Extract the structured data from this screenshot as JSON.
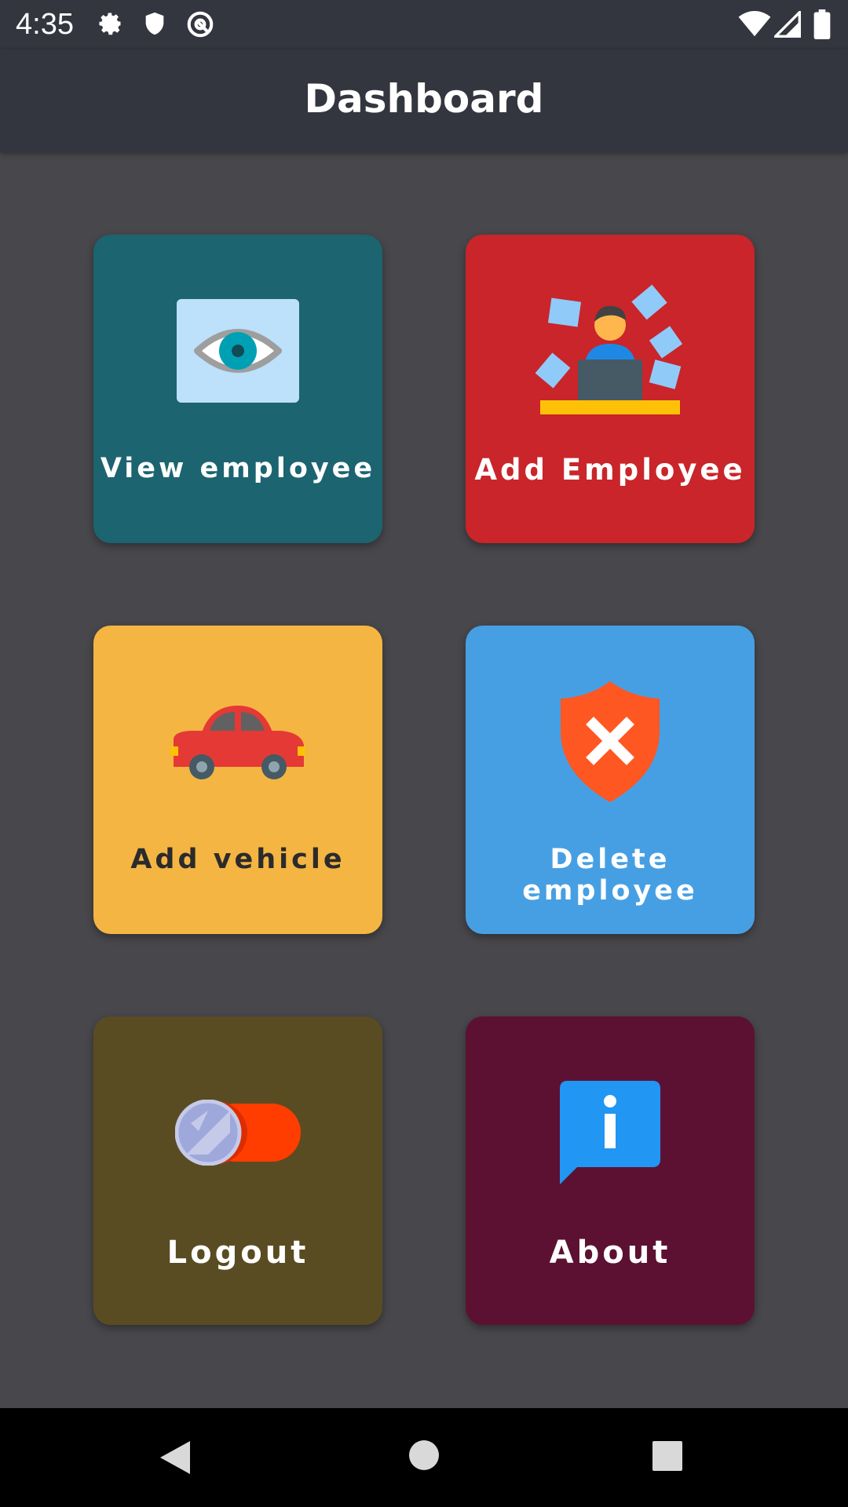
{
  "status_bar": {
    "time": "4:35",
    "left_icons": [
      "gear-icon",
      "shield-icon",
      "at-sign-icon"
    ],
    "right_icons": [
      "wifi-icon",
      "signal-icon",
      "battery-icon"
    ]
  },
  "app_bar": {
    "title": "Dashboard"
  },
  "cards": [
    {
      "label": "View employee",
      "icon": "eye-icon",
      "color": "#1b6470",
      "label_color": "#ffffff"
    },
    {
      "label": "Add Employee",
      "icon": "employee-desk-icon",
      "color": "#c9252a",
      "label_color": "#ffffff"
    },
    {
      "label": "Add vehicle",
      "icon": "car-icon",
      "color": "#f4b543",
      "label_color": "#2b2b2b"
    },
    {
      "label": "Delete employee",
      "icon": "shield-x-icon",
      "color": "#479fe3",
      "label_color": "#ffffff"
    },
    {
      "label": "Logout",
      "icon": "toggle-icon",
      "color": "#5a4c22",
      "label_color": "#ffffff"
    },
    {
      "label": "About",
      "icon": "info-chat-icon",
      "color": "#5c1133",
      "label_color": "#ffffff"
    }
  ],
  "nav_bar": {
    "icons": [
      "back-icon",
      "home-icon",
      "recents-icon"
    ]
  }
}
